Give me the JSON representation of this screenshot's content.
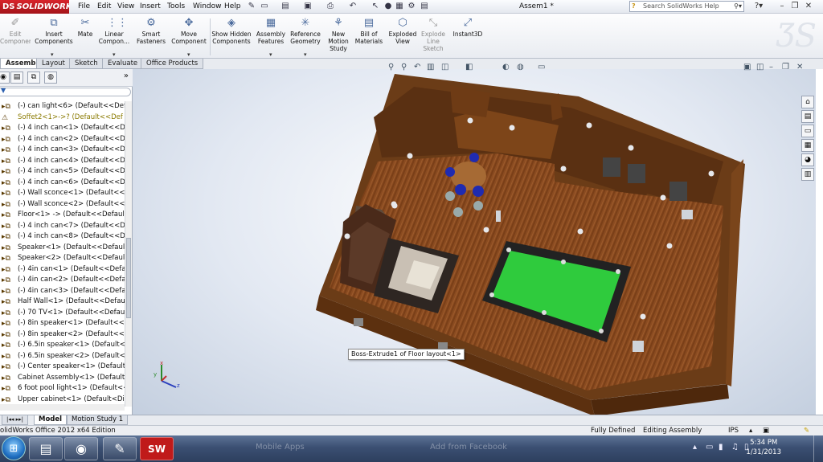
{
  "app": {
    "logo_brand": "DS",
    "logo_name": "SOLIDWORKS",
    "document_title": "Assem1 *"
  },
  "menu": [
    "File",
    "Edit",
    "View",
    "Insert",
    "Tools",
    "Window",
    "Help"
  ],
  "search": {
    "placeholder": "Search SolidWorks Help"
  },
  "ribbon": {
    "edit_component": "Edit Component",
    "insert_components": "Insert Components",
    "mate": "Mate",
    "linear_component": "Linear Compon...",
    "smart_fasteners": "Smart Fasteners",
    "move_component": "Move Component",
    "show_hidden": "Show Hidden Components",
    "assembly_features": "Assembly Features",
    "reference_geometry": "Reference Geometry",
    "new_motion_study": "New Motion Study",
    "bill_of_materials": "Bill of Materials",
    "exploded_view": "Exploded View",
    "explode_line_sketch": "Explode Line Sketch",
    "instant3d": "Instant3D"
  },
  "command_tabs": [
    "Assembly",
    "Layout",
    "Sketch",
    "Evaluate",
    "Office Products"
  ],
  "feature_tree": [
    "(-) can light<6> (Default<<Defau",
    "Soffet2<1>->? (Default<<Def",
    "(-) 4 inch can<1> (Default<<Defa",
    "(-) 4 inch can<2> (Default<<Defa",
    "(-) 4 inch can<3> (Default<<Defa",
    "(-) 4 inch can<4> (Default<<Defa",
    "(-) 4 inch can<5> (Default<<Defa",
    "(-) 4 inch can<6> (Default<<Defa",
    "(-) Wall sconce<1> (Default<<De",
    "(-) Wall sconce<2> (Default<<De",
    "Floor<1> -> (Default<<Default>_",
    "(-) 4 inch can<7> (Default<<Defa",
    "(-) 4 inch can<8> (Default<<Defa",
    "Speaker<1> (Default<<Default>_",
    "Speaker<2> (Default<<Default>_",
    "(-) 4in can<1> (Default<<Default",
    "(-) 4in can<2> (Default<<Default",
    "(-) 4in can<3> (Default<<Default",
    "Half Wall<1> (Default<<Default>",
    "(-) 70 TV<1> (Default<<Default>",
    "(-) 8in speaker<1> (Default<<De",
    "(-) 8in speaker<2> (Default<<De",
    "(-) 6.5in speaker<1> (Default<<D",
    "(-) 6.5in speaker<2> (Default<<D",
    "(-) Center speaker<1> (Default<<",
    "Cabinet Assembly<1> (Default<<",
    "6 foot pool light<1> (Default<<D",
    "Upper cabinet<1> (Default<Disol"
  ],
  "viewport": {
    "tooltip": "Boss-Extrude1 of Floor layout<1>",
    "triad": {
      "x": "x",
      "y": "y",
      "z": "z"
    }
  },
  "bottom_tabs": [
    "Model",
    "Motion Study 1"
  ],
  "status": {
    "product": "olidWorks Office 2012 x64 Edition",
    "defined": "Fully Defined",
    "mode": "Editing Assembly",
    "units": "IPS"
  },
  "taskbar": {
    "ghost_mobile": "Mobile Apps",
    "ghost_facebook": "Add from Facebook",
    "time": "5:34 PM",
    "date": "1/31/2013"
  }
}
